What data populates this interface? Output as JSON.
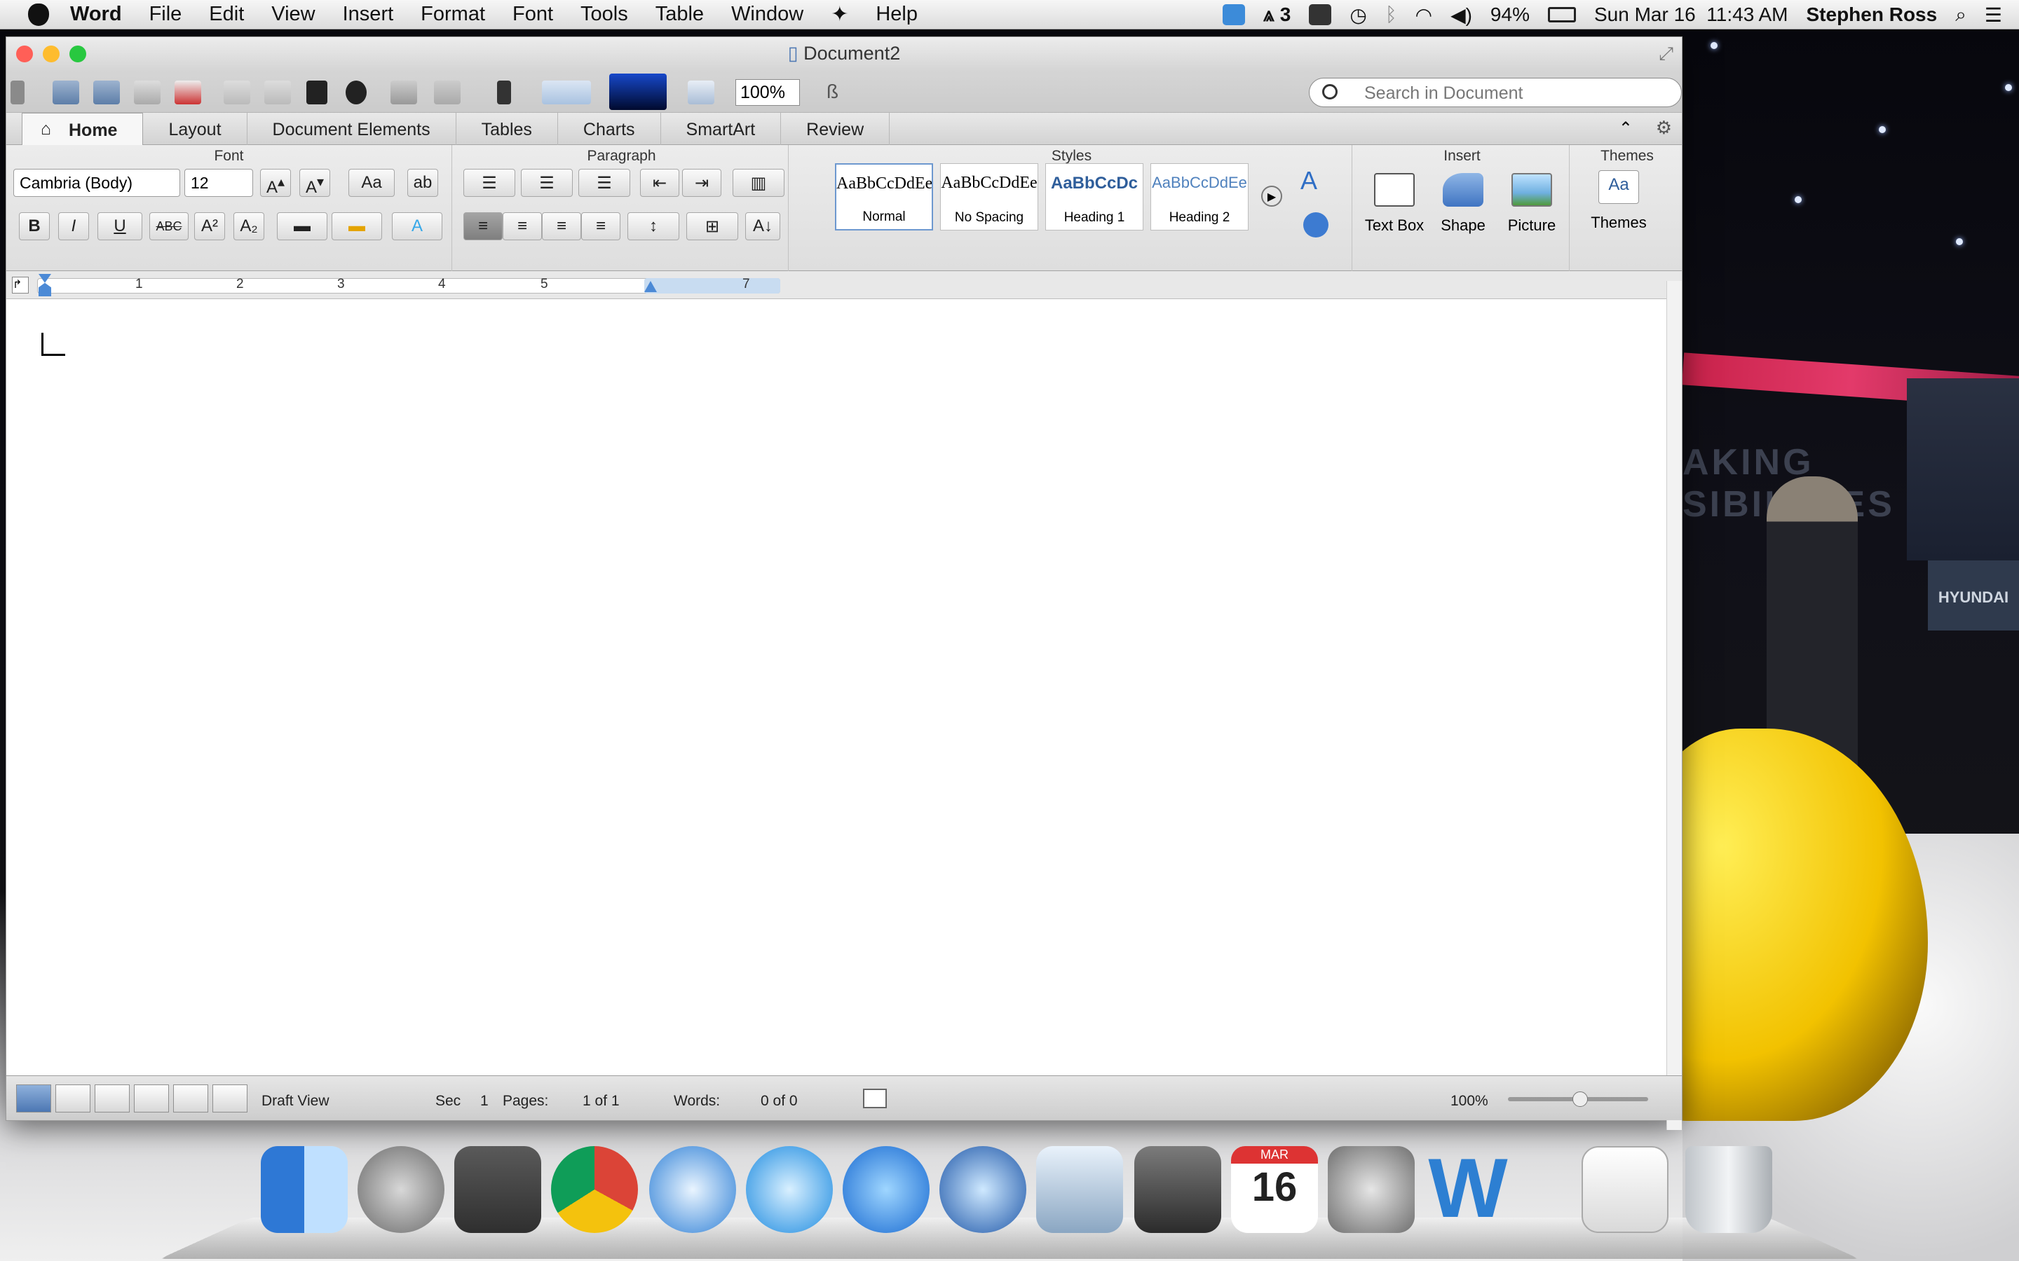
{
  "menubar": {
    "app_name": "Word",
    "items": [
      "File",
      "Edit",
      "View",
      "Insert",
      "Format",
      "Font",
      "Tools",
      "Table",
      "Window",
      "Help"
    ],
    "status": {
      "adobe_count": "3",
      "battery": "94%",
      "datetime": "Sun Mar 16  11:43 AM",
      "user": "Stephen Ross"
    }
  },
  "window": {
    "title": "Document2",
    "zoom_value": "100%",
    "search_placeholder": "Search in Document",
    "tabs": [
      "Home",
      "Layout",
      "Document Elements",
      "Tables",
      "Charts",
      "SmartArt",
      "Review"
    ],
    "ribbon": {
      "groups": {
        "font": "Font",
        "paragraph": "Paragraph",
        "styles": "Styles",
        "insert": "Insert",
        "themes": "Themes"
      },
      "font_name": "Cambria (Body)",
      "font_size": "12",
      "styles": [
        {
          "preview": "AaBbCcDdEe",
          "name": "Normal"
        },
        {
          "preview": "AaBbCcDdEe",
          "name": "No Spacing"
        },
        {
          "preview": "AaBbCcDc",
          "name": "Heading 1"
        },
        {
          "preview": "AaBbCcDdEe",
          "name": "Heading 2"
        }
      ],
      "insert_items": [
        "Text Box",
        "Shape",
        "Picture"
      ],
      "themes_label": "Themes",
      "themes_preview": "Aa"
    },
    "ruler_numbers": [
      "1",
      "2",
      "3",
      "4",
      "5",
      "7"
    ],
    "status": {
      "view": "Draft View",
      "sec_label": "Sec",
      "sec_value": "1",
      "pages_label": "Pages:",
      "pages_value": "1 of 1",
      "words_label": "Words:",
      "words_value": "0 of 0",
      "zoom": "100%"
    }
  },
  "desktop": {
    "sign_text": "HYUNDAI",
    "booth_text": "AKING\nSIBILITIES"
  },
  "dock": {
    "items": [
      "finder-icon",
      "launchpad-icon",
      "image-capture-icon",
      "chrome-icon",
      "safari-icon",
      "itunes-icon",
      "app-store-icon",
      "quicktime-icon",
      "mail-icon",
      "facetime-icon",
      "calendar-icon",
      "system-preferences-icon",
      "word-icon",
      "recent-docs-icon",
      "trash-icon"
    ],
    "calendar_month": "MAR",
    "calendar_day": "16"
  },
  "colors": {
    "accent": "#4c77b3",
    "close": "#ff5f57",
    "minimize": "#febc2e",
    "zoom": "#28c840"
  }
}
